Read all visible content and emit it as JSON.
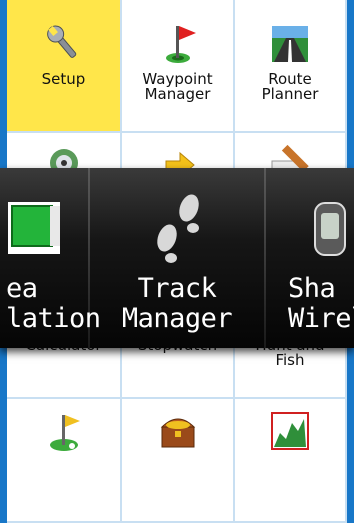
{
  "menu": {
    "cells": [
      {
        "label": "Setup",
        "icon": "wrench-icon"
      },
      {
        "label": "Waypoint\nManager",
        "icon": "flag-icon"
      },
      {
        "label": "Route\nPlanner",
        "icon": "road-icon"
      },
      {
        "label": "",
        "icon": "speaker-icon"
      },
      {
        "label": "",
        "icon": "arrow-icon"
      },
      {
        "label": "",
        "icon": "pencil-icon"
      },
      {
        "label": "Calculator",
        "icon": "calculator-icon"
      },
      {
        "label": "Stopwatch",
        "icon": "stopwatch-icon"
      },
      {
        "label": "Hunt and\nFish",
        "icon": "fish-icon"
      },
      {
        "label": "",
        "icon": "golf-flag-icon"
      },
      {
        "label": "",
        "icon": "treasure-chest-icon"
      },
      {
        "label": "",
        "icon": "elevation-chart-icon"
      }
    ],
    "selected_color": "#ffe64a"
  },
  "carousel": {
    "left": {
      "label": "ea\nlation",
      "icon": "area-calculation-icon"
    },
    "center": {
      "label": "Track\nManager",
      "icon": "footprints-icon"
    },
    "right": {
      "label": "Sha\nWirel",
      "icon": "wireless-share-icon"
    }
  }
}
